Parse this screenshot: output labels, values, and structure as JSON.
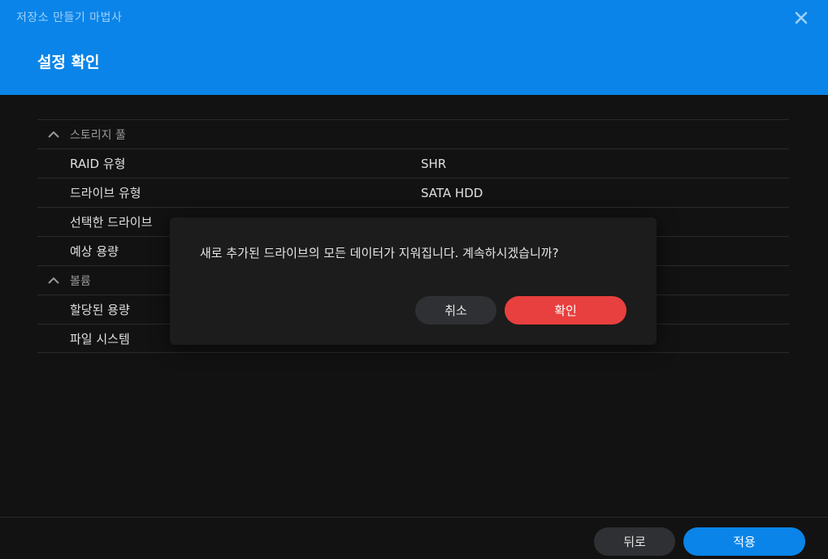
{
  "header": {
    "wizard_title": "저장소 만들기 마법사",
    "page_title": "설정 확인"
  },
  "summary": {
    "sections": [
      {
        "title": "스토리지 풀",
        "rows": [
          {
            "label": "RAID 유형",
            "value": "SHR"
          },
          {
            "label": "드라이브 유형",
            "value": "SATA HDD"
          },
          {
            "label": "선택한 드라이브",
            "value": ""
          },
          {
            "label": "예상 용량",
            "value": ""
          }
        ]
      },
      {
        "title": "볼륨",
        "rows": [
          {
            "label": "할당된 용량",
            "value": ""
          },
          {
            "label": "파일 시스템",
            "value": ""
          }
        ]
      }
    ]
  },
  "modal": {
    "message": "새로 추가된 드라이브의 모든 데이터가 지워집니다. 계속하시겠습니까?",
    "cancel_label": "취소",
    "confirm_label": "확인"
  },
  "footer": {
    "back_label": "뒤로",
    "apply_label": "적용"
  },
  "colors": {
    "header_bg": "#0a84e8",
    "confirm": "#e8403e",
    "apply": "#0a84e8"
  }
}
